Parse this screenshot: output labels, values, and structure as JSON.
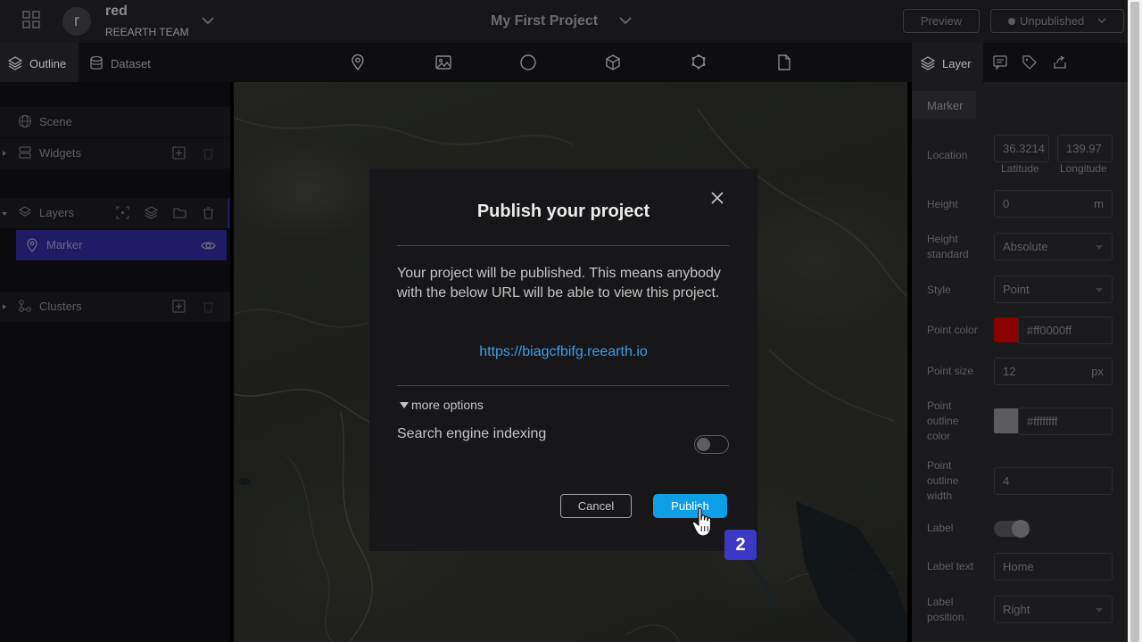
{
  "header": {
    "workspace_name": "red",
    "workspace_team": "REEARTH TEAM",
    "avatar_letter": "r",
    "project_title": "My First Project",
    "preview_label": "Preview",
    "status_label": "Unpublished"
  },
  "left_tabs": {
    "outline": "Outline",
    "dataset": "Dataset"
  },
  "toolbar_icons": [
    "marker-tool-icon",
    "photo-tool-icon",
    "sphere-tool-icon",
    "model-tool-icon",
    "box-tool-icon",
    "file-tool-icon"
  ],
  "right_tabs": {
    "layer": "Layer"
  },
  "outline": {
    "scene": "Scene",
    "widgets": "Widgets",
    "layers": "Layers",
    "marker": "Marker",
    "clusters": "Clusters"
  },
  "properties": {
    "section": "Marker",
    "location_label": "Location",
    "latitude_value": "36.3214",
    "longitude_value": "139.97",
    "latitude_label": "Latitude",
    "longitude_label": "Longitude",
    "height_label": "Height",
    "height_value": "0",
    "height_unit": "m",
    "height_standard_label": "Height standard",
    "height_standard_value": "Absolute",
    "style_label": "Style",
    "style_value": "Point",
    "point_color_label": "Point color",
    "point_color_value": "#ff0000ff",
    "point_color_swatch": "#8b0000",
    "point_size_label": "Point size",
    "point_size_value": "12",
    "point_size_unit": "px",
    "outline_color_label": "Point outline color",
    "outline_color_value": "#ffffffff",
    "outline_color_swatch": "#5c5b5e",
    "outline_width_label": "Point outline width",
    "outline_width_value": "4",
    "label_label": "Label",
    "label_text_label": "Label text",
    "label_text_value": "Home",
    "label_position_label": "Label position",
    "label_position_value": "Right"
  },
  "modal": {
    "title": "Publish your project",
    "body": "Your project will be published. This means anybody with the below URL will be able to view this project.",
    "url": "https://biagcfbifg.reearth.io",
    "more_options": "more options",
    "search_indexing_label": "Search engine indexing",
    "search_indexing_on": false,
    "cancel_label": "Cancel",
    "publish_label": "Publish"
  },
  "step_badge": "2",
  "colors": {
    "accent": "#0f9fe6",
    "url": "#3b9fe8",
    "selected_layer": "#1e1c64",
    "badge": "#3a38c4"
  }
}
